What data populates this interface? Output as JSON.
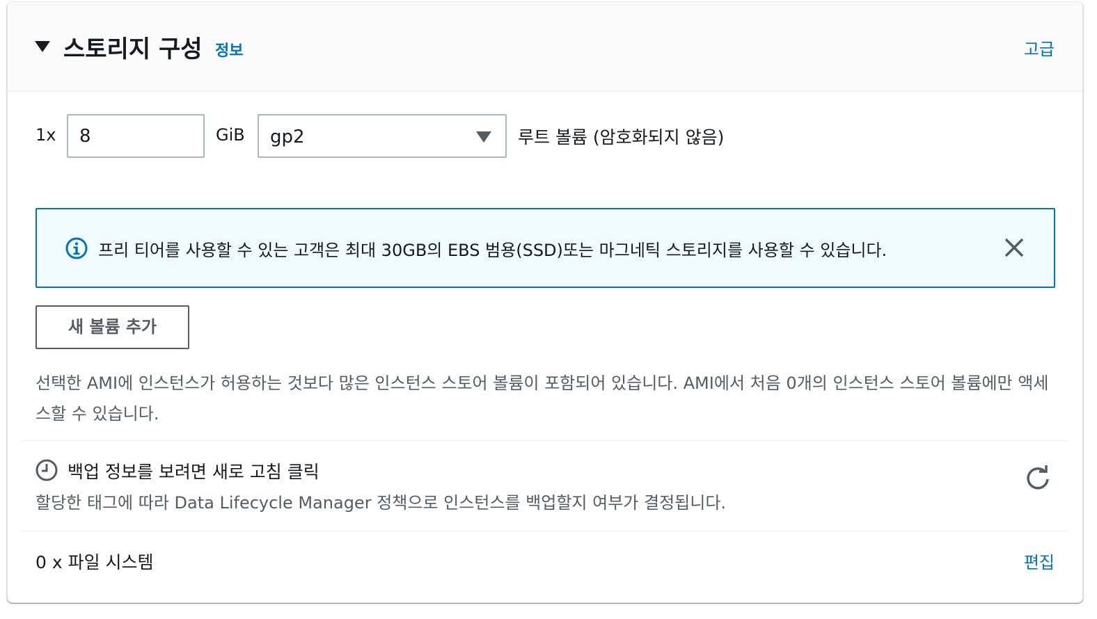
{
  "header": {
    "title": "스토리지 구성",
    "info_label": "정보",
    "advanced_label": "고급"
  },
  "volume": {
    "count": "1x",
    "size": "8",
    "unit": "GiB",
    "type": "gp2",
    "root_label": "루트 볼륨  (암호화되지 않음)"
  },
  "alert": {
    "text": "프리 티어를 사용할 수 있는 고객은 최대 30GB의 EBS 범용(SSD)또는 마그네틱 스토리지를 사용할 수 있습니다.",
    "icon": "info-icon",
    "close_icon": "close-icon"
  },
  "add_volume_label": "새 볼륨 추가",
  "instance_store_warning": "선택한 AMI에 인스턴스가 허용하는 것보다 많은 인스턴스 스토어 볼륨이 포함되어 있습니다. AMI에서 처음 0개의 인스턴스 스토어 볼륨에만 액세스할 수 있습니다.",
  "backup": {
    "title": "백업 정보를 보려면 새로 고침 클릭",
    "description": "할당한 태그에 따라 Data Lifecycle Manager 정책으로 인스턴스를 백업할지 여부가 결정됩니다.",
    "icon": "clock-icon",
    "refresh_icon": "refresh-icon"
  },
  "filesystems": {
    "label": "0 x 파일 시스템",
    "edit_label": "편집"
  },
  "colors": {
    "link": "#0073bb",
    "alert_bg": "#f1faff",
    "text": "#16191f",
    "secondary_text": "#545b64"
  }
}
